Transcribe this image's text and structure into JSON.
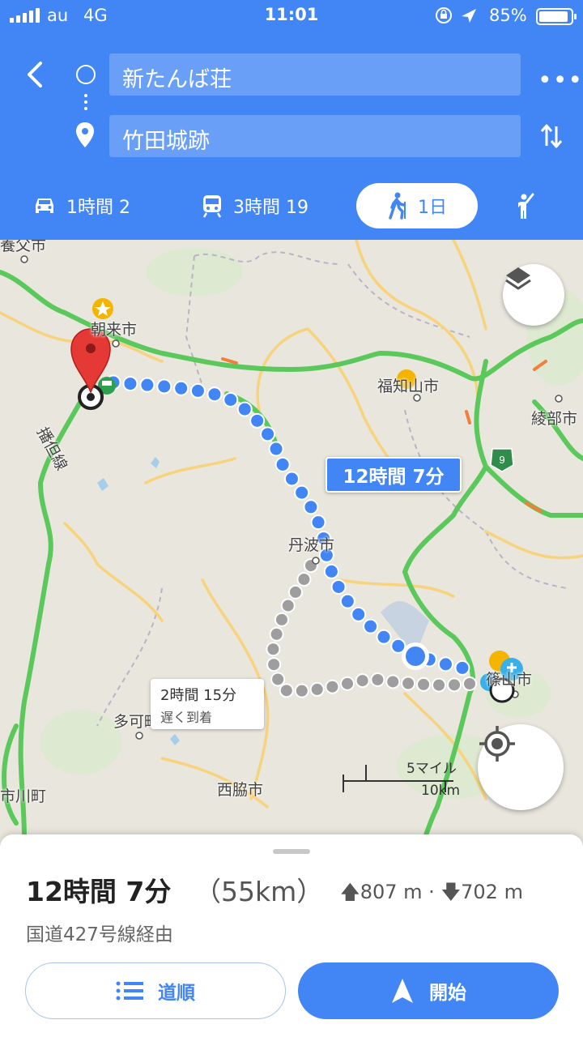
{
  "status_bar": {
    "carrier": "au",
    "network": "4G",
    "time": "11:01",
    "battery": "85%"
  },
  "search": {
    "origin": "新たんば荘",
    "destination": "竹田城跡"
  },
  "modes": [
    {
      "id": "drive",
      "label": "1時間 2",
      "icon": "car-icon"
    },
    {
      "id": "transit",
      "label": "3時間 19",
      "icon": "train-icon"
    },
    {
      "id": "walk",
      "label": "1日",
      "icon": "walking-icon",
      "selected": true
    },
    {
      "id": "ride",
      "label": "",
      "icon": "hail-ride-icon"
    }
  ],
  "map": {
    "labels": [
      "朝来市",
      "福知山市",
      "綾部市",
      "丹波市",
      "篠山市",
      "多可町",
      "西脇市",
      "市川町",
      "播但線",
      "養父市"
    ],
    "route_badge": "9",
    "primary_route_time": "12時間 7分",
    "alt_route_time": "2時間 15分",
    "alt_route_note": "遅く到着",
    "scale_imperial": "5マイル",
    "scale_metric": "10km"
  },
  "summary": {
    "duration": "12時間 7分",
    "distance": "（55km）",
    "ascent": "807 m",
    "descent": "702 m",
    "separator": "·",
    "via": "国道427号線経由"
  },
  "buttons": {
    "steps": "道順",
    "start": "開始"
  },
  "colors": {
    "accent": "#4286f5",
    "road_green": "#5ac85a",
    "pin_red": "#e53935"
  }
}
